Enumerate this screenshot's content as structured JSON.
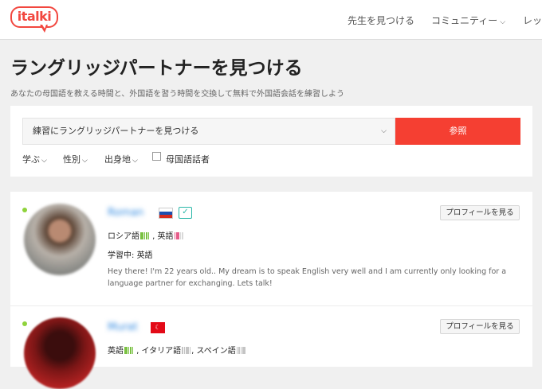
{
  "header": {
    "logo": "italki",
    "nav": [
      {
        "label": "先生を見つける"
      },
      {
        "label": "コミュニティー",
        "has_dropdown": true
      },
      {
        "label": "レッ"
      }
    ]
  },
  "page": {
    "title": "ラングリッジパートナーを見つける",
    "subtitle": "あなたの母国語を教える時間と、外国語を習う時間を交換して無料で外国語会話を練習しよう"
  },
  "search": {
    "select_value": "練習にラングリッジパートナーを見つける",
    "button_label": "参照",
    "filters": [
      {
        "label": "学ぶ"
      },
      {
        "label": "性別"
      },
      {
        "label": "出身地"
      }
    ],
    "native_checkbox_label": "母国語話者",
    "native_checked": false
  },
  "partners": [
    {
      "name": "Roman",
      "flag": "Russia",
      "verified": true,
      "online": true,
      "languages": [
        {
          "name": "ロシア語",
          "level": 5,
          "color": "#7ac142"
        },
        {
          "name": "英語",
          "level": 3,
          "color": "#e65c8a"
        }
      ],
      "learning_label": "学習中:",
      "learning": "英語",
      "bio": "Hey there! I'm 22 years old.. My dream is to speak English very well and I am currently only looking for a language partner for exchanging. Lets talk!",
      "profile_button": "プロフィールを見る"
    },
    {
      "name": "Murat",
      "flag": "Turkey",
      "verified": false,
      "online": true,
      "languages": [
        {
          "name": "英語",
          "level": 5,
          "color": "#7ac142"
        },
        {
          "name": "イタリア語",
          "level": 5,
          "color": "#c4c4c4"
        },
        {
          "name": "スペイン語",
          "level": 5,
          "color": "#c4c4c4"
        }
      ],
      "profile_button": "プロフィールを見る"
    }
  ],
  "separators": {
    "comma": ","
  },
  "icons": {
    "chevron": "chevron-down-icon",
    "verified": "verified-check-icon"
  },
  "colors": {
    "brand": "#f2473f",
    "search_button": "#f53f32",
    "link": "#2f88e0"
  }
}
